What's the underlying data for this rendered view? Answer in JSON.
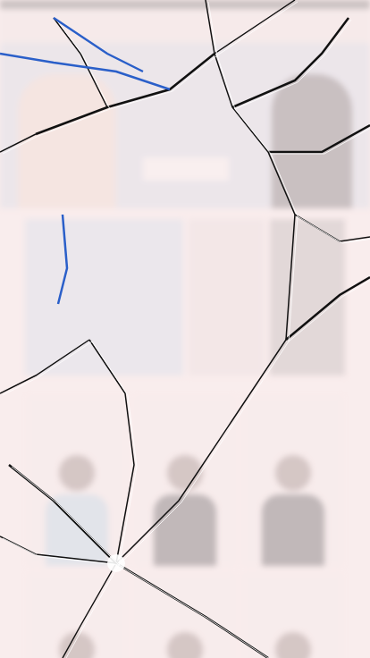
{
  "hero": {
    "banner": "photo",
    "button": {}
  },
  "featured": [
    {},
    {},
    {}
  ],
  "products": [
    {},
    {},
    {},
    {},
    {},
    {}
  ]
}
